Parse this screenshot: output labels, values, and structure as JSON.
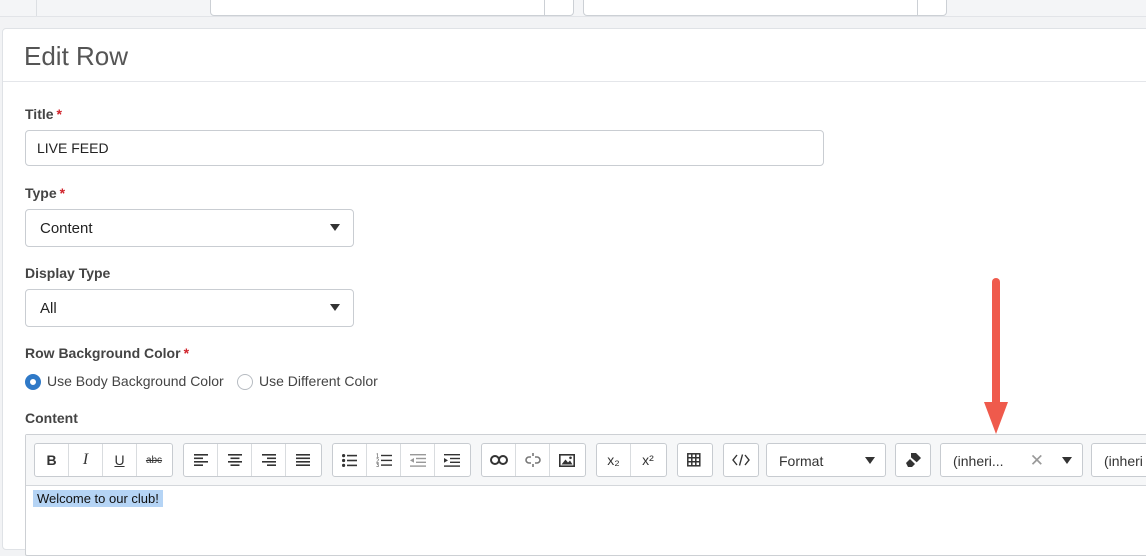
{
  "form": {
    "header": "Edit Row",
    "required_mark": "*",
    "title": {
      "label": "Title",
      "value": "LIVE FEED"
    },
    "type": {
      "label": "Type",
      "value": "Content"
    },
    "display_type": {
      "label": "Display Type",
      "value": "All"
    },
    "row_background": {
      "label": "Row Background Color",
      "options": [
        "Use Body Background Color",
        "Use Different Color"
      ],
      "selected": "Use Body Background Color"
    },
    "content": {
      "label": "Content",
      "body_text": "Welcome to our club!"
    }
  },
  "editor": {
    "buttons": {
      "bold": "B",
      "italic": "I",
      "underline": "U",
      "strike": "abc",
      "subscript": "x₂",
      "superscript": "x²"
    },
    "format_select": "Format",
    "font_select": "(inheri...",
    "font_size_select": "(inheri",
    "clear_symbol": "✕"
  },
  "colors": {
    "accent": "#2f79c7",
    "required": "#d0232b",
    "selection": "#b5d4f5",
    "annotation_arrow": "#ef5a4c"
  },
  "icons": [
    "align-left-icon",
    "align-center-icon",
    "align-right-icon",
    "align-justify-icon",
    "bulleted-list-icon",
    "numbered-list-icon",
    "outdent-icon",
    "indent-icon",
    "link-icon",
    "unlink-icon",
    "image-icon",
    "table-icon",
    "source-code-icon",
    "remove-format-icon"
  ]
}
